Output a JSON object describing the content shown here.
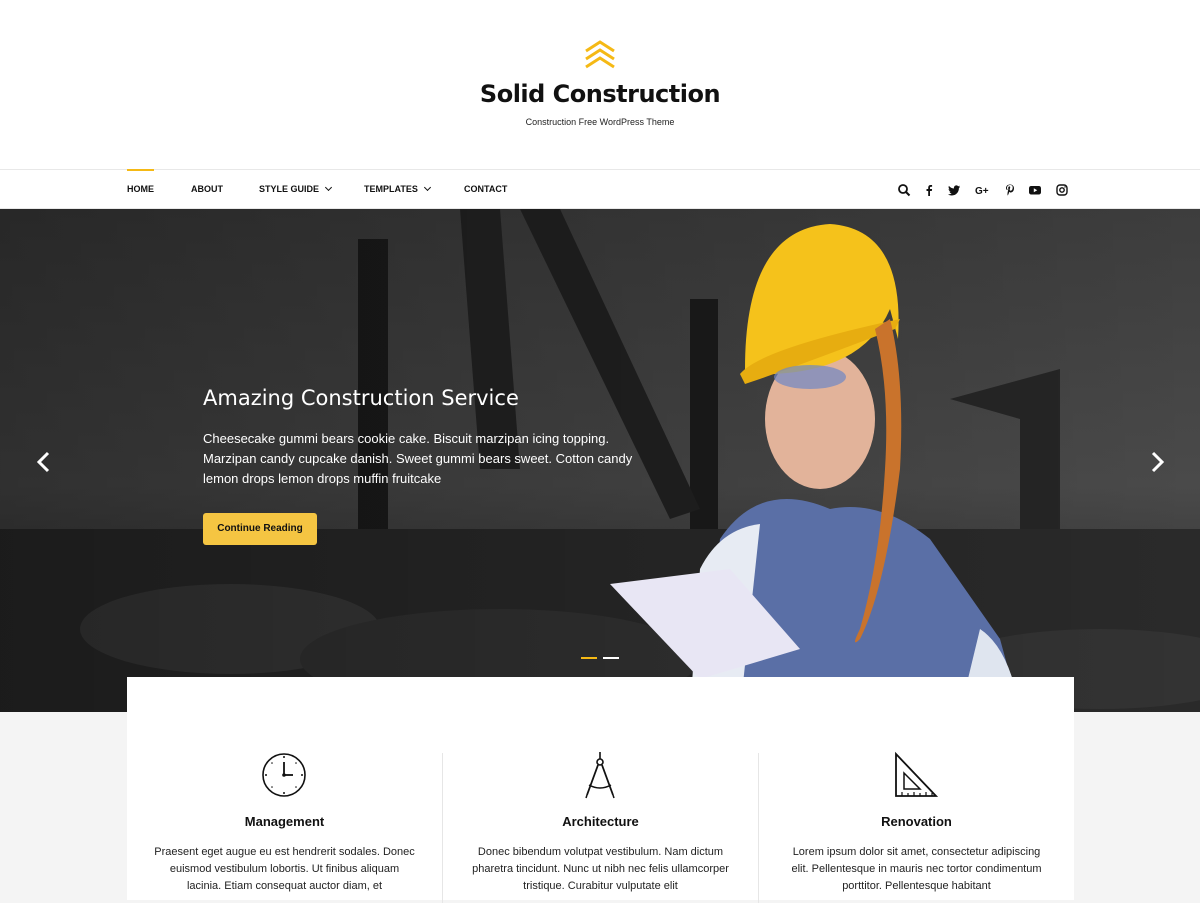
{
  "site": {
    "title": "Solid Construction",
    "tagline": "Construction Free WordPress Theme",
    "accent_color": "#f5b915",
    "logo_icon": "chevrons-up-icon"
  },
  "nav": {
    "items": [
      {
        "label": "HOME",
        "active": true
      },
      {
        "label": "ABOUT",
        "active": false
      },
      {
        "label": "STYLE GUIDE",
        "active": false,
        "has_dropdown": true
      },
      {
        "label": "TEMPLATES",
        "active": false,
        "has_dropdown": true
      },
      {
        "label": "CONTACT",
        "active": false
      }
    ],
    "icons": [
      "search-icon",
      "facebook-icon",
      "twitter-icon",
      "google-plus-icon",
      "pinterest-icon",
      "youtube-icon",
      "instagram-icon"
    ]
  },
  "hero": {
    "title": "Amazing Construction Service",
    "text": "Cheesecake gummi bears cookie cake. Biscuit marzipan icing topping. Marzipan candy cupcake danish. Sweet gummi bears sweet. Cotton candy lemon drops lemon drops muffin fruitcake",
    "button_label": "Continue Reading",
    "button_color": "#f5c542",
    "slides": 2,
    "active_slide": 1
  },
  "features": [
    {
      "icon": "clock-icon",
      "title": "Management",
      "text": "Praesent eget augue eu est hendrerit sodales. Donec euismod vestibulum lobortis. Ut finibus aliquam lacinia. Etiam consequat auctor diam, et"
    },
    {
      "icon": "compass-icon",
      "title": "Architecture",
      "text": "Donec bibendum volutpat vestibulum. Nam dictum pharetra tincidunt. Nunc ut nibh nec felis ullamcorper tristique. Curabitur vulputate elit"
    },
    {
      "icon": "set-square-icon",
      "title": "Renovation",
      "text": "Lorem ipsum dolor sit amet, consectetur adipiscing elit. Pellentesque in mauris nec tortor condimentum porttitor. Pellentesque habitant"
    }
  ]
}
